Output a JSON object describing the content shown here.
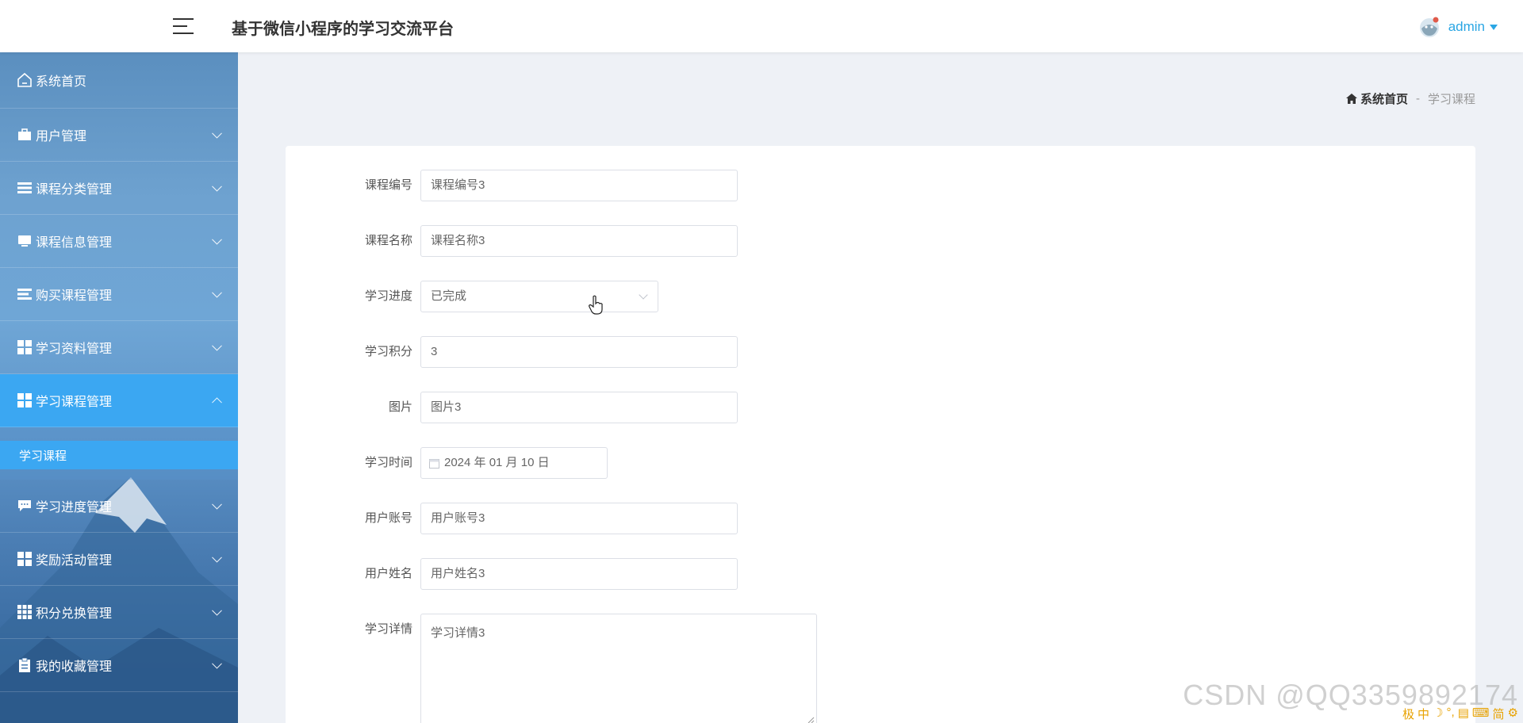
{
  "header": {
    "title": "基于微信小程序的学习交流平台",
    "username": "admin"
  },
  "sidebar": {
    "items": [
      {
        "label": "系统首页",
        "icon": "home-icon"
      },
      {
        "label": "用户管理",
        "icon": "briefcase-icon"
      },
      {
        "label": "课程分类管理",
        "icon": "list-icon"
      },
      {
        "label": "课程信息管理",
        "icon": "monitor-icon"
      },
      {
        "label": "购买课程管理",
        "icon": "list-icon"
      },
      {
        "label": "学习资料管理",
        "icon": "grid-icon"
      },
      {
        "label": "学习课程管理",
        "icon": "grid-icon",
        "active": true
      },
      {
        "label": "学习进度管理",
        "icon": "chat-icon"
      },
      {
        "label": "奖励活动管理",
        "icon": "grid-icon"
      },
      {
        "label": "积分兑换管理",
        "icon": "table-icon"
      },
      {
        "label": "我的收藏管理",
        "icon": "clipboard-icon"
      }
    ],
    "submenu": {
      "label": "学习课程"
    }
  },
  "breadcrumb": {
    "home": "系统首页",
    "separator": "-",
    "current": "学习课程"
  },
  "form": {
    "course_no": {
      "label": "课程编号",
      "value": "课程编号3"
    },
    "course_name": {
      "label": "课程名称",
      "value": "课程名称3"
    },
    "progress": {
      "label": "学习进度",
      "value": "已完成"
    },
    "points": {
      "label": "学习积分",
      "value": "3"
    },
    "image": {
      "label": "图片",
      "value": "图片3"
    },
    "study_time": {
      "label": "学习时间",
      "value": "2024 年 01 月 10 日"
    },
    "account": {
      "label": "用户账号",
      "value": "用户账号3"
    },
    "user_name": {
      "label": "用户姓名",
      "value": "用户姓名3"
    },
    "details": {
      "label": "学习详情",
      "value": "学习详情3"
    }
  },
  "watermark": "CSDN @QQ3359892174",
  "ime": [
    "极",
    "中",
    "☽",
    "°,",
    "▤",
    "⌨",
    "简",
    "⚙"
  ],
  "colors": {
    "accent": "#3ba7f2",
    "username": "#2aa6e4"
  }
}
